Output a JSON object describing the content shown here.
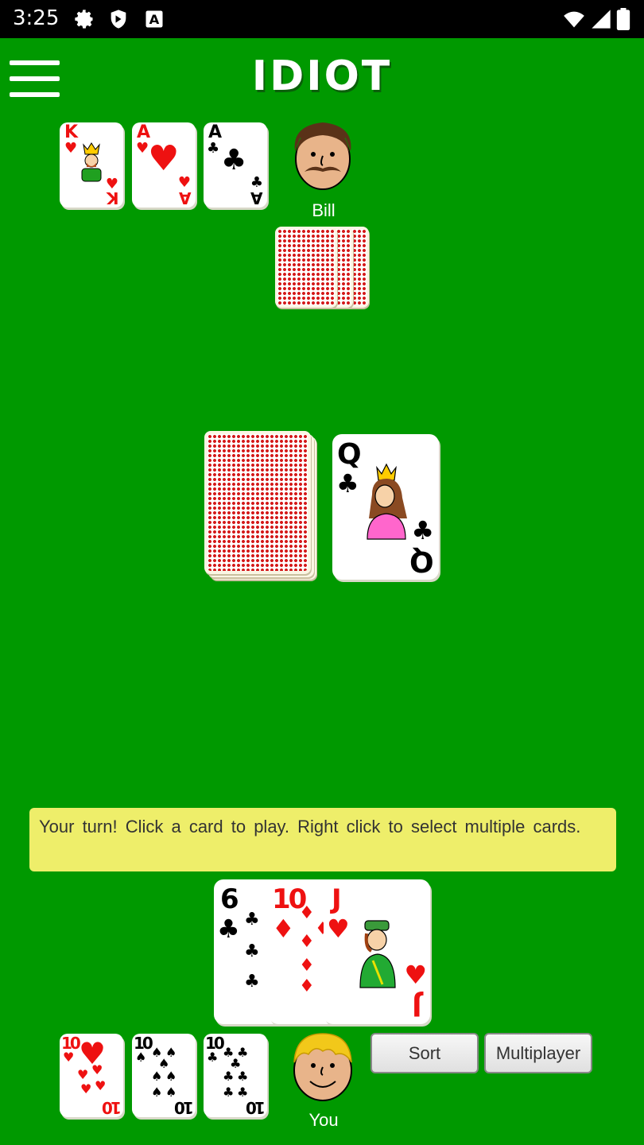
{
  "status_bar": {
    "time": "3:25"
  },
  "header": {
    "title": "IDIOT"
  },
  "opponent": {
    "name": "Bill",
    "face_up_cards": [
      {
        "rank": "K",
        "suit": "♥",
        "color": "red"
      },
      {
        "rank": "A",
        "suit": "♥",
        "color": "red"
      },
      {
        "rank": "A",
        "suit": "♣",
        "color": "black"
      }
    ],
    "hand_count": 3
  },
  "table": {
    "discard_top": {
      "rank": "Q",
      "suit": "♣",
      "color": "black"
    }
  },
  "message": "Your turn! Click a card to play. Right click to select multiple cards.",
  "player": {
    "name": "You",
    "hand": [
      {
        "rank": "6",
        "suit": "♣",
        "color": "black"
      },
      {
        "rank": "10",
        "suit": "♦",
        "color": "red"
      },
      {
        "rank": "J",
        "suit": "♥",
        "color": "red"
      }
    ],
    "face_up_cards": [
      {
        "rank": "10",
        "suit": "♥",
        "color": "red"
      },
      {
        "rank": "10",
        "suit": "♠",
        "color": "black"
      },
      {
        "rank": "10",
        "suit": "♣",
        "color": "black"
      }
    ]
  },
  "buttons": {
    "sort": "Sort",
    "multiplayer": "Multiplayer"
  },
  "colors": {
    "table": "#009900",
    "message_bg": "#eeee6a",
    "card_red": "#ee1111"
  }
}
